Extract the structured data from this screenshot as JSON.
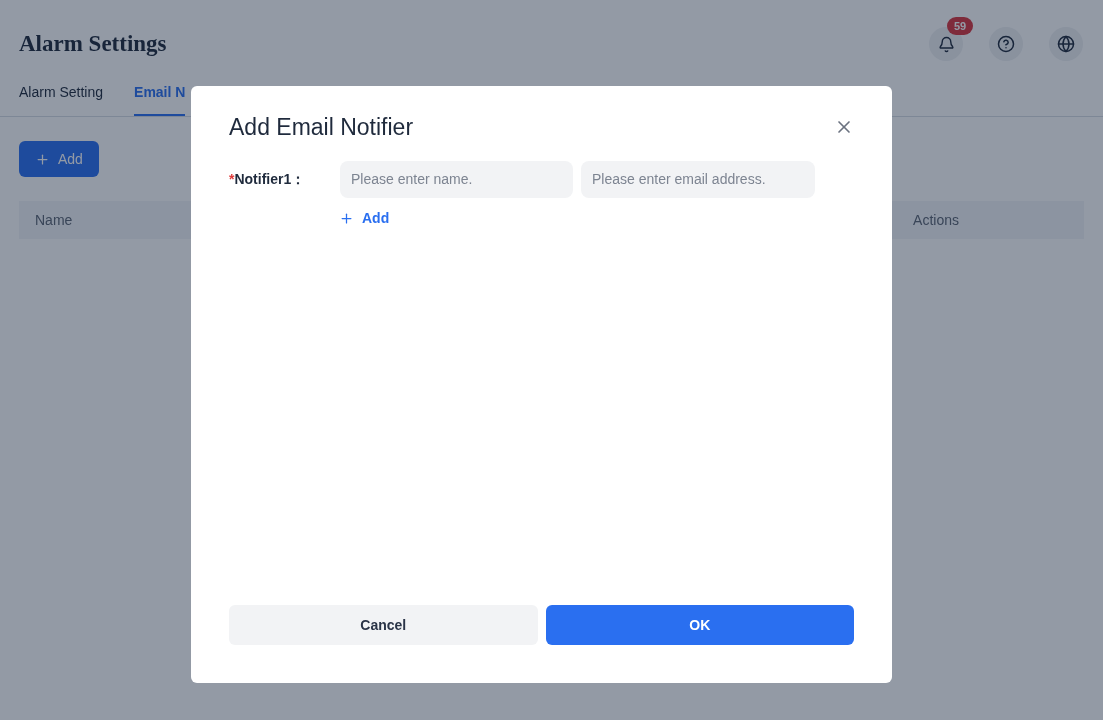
{
  "page": {
    "title": "Alarm Settings",
    "notification_count": "59"
  },
  "tabs": [
    {
      "label": "Alarm Setting",
      "selected": false
    },
    {
      "label": "Email N",
      "selected": true
    }
  ],
  "add_button": {
    "label": "Add"
  },
  "table": {
    "columns": [
      "Name",
      "Actions"
    ]
  },
  "dialog": {
    "title": "Add Email Notifier",
    "notifiers": [
      {
        "required_mark": "*",
        "label": "Notifier1：",
        "name_placeholder": "Please enter name.",
        "email_placeholder": "Please enter email address."
      }
    ],
    "add_link": "Add",
    "buttons": [
      {
        "kind": "secondary",
        "label": "Cancel"
      },
      {
        "kind": "primary",
        "label": "OK"
      }
    ]
  }
}
